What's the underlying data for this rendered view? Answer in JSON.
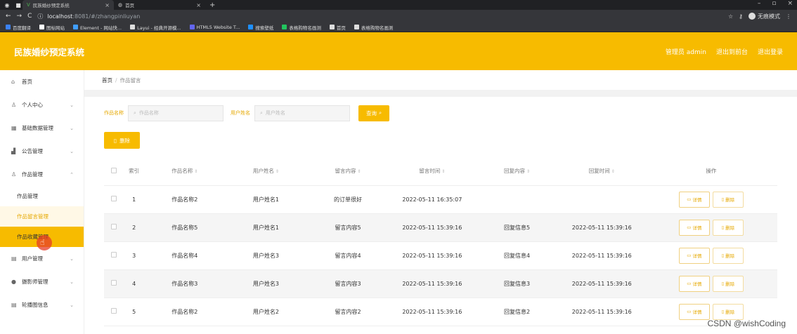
{
  "browser": {
    "tabs": [
      {
        "title": "民族婚纱预定系统",
        "active": true
      },
      {
        "title": "首页",
        "active": false
      }
    ],
    "url_host": "localhost",
    "url_path": ":8081/#/zhangpinliuyan",
    "profile_label": "无痕模式",
    "bookmarks": [
      {
        "label": "百度翻译",
        "color": "#3b82f6"
      },
      {
        "label": "图标网站",
        "color": "#ffffff"
      },
      {
        "label": "Element - 网站快...",
        "color": "#409eff"
      },
      {
        "label": "Layui - 经典开源模...",
        "color": "#dddddd"
      },
      {
        "label": "HTML5 Website T...",
        "color": "#6366f1"
      },
      {
        "label": "搜索壁纸",
        "color": "#1e90ff"
      },
      {
        "label": "表格购物名画测",
        "color": "#22c55e"
      },
      {
        "label": "首页",
        "color": "#dddddd"
      },
      {
        "label": "表格购物名画测",
        "color": "#dddddd"
      }
    ]
  },
  "header": {
    "brand": "民族婚纱预定系统",
    "user": "管理员 admin",
    "back_label": "退出到前台",
    "logout_label": "退出登录"
  },
  "sidebar": {
    "items": [
      {
        "label": "首页",
        "icon": "home-icon",
        "glyph": "⌂",
        "chevron": false
      },
      {
        "label": "个人中心",
        "icon": "user-icon",
        "glyph": "♙",
        "chevron": true
      },
      {
        "label": "基础数据管理",
        "icon": "grid-icon",
        "glyph": "▦",
        "chevron": true
      },
      {
        "label": "公告管理",
        "icon": "chart-icon",
        "glyph": "▟",
        "chevron": true
      },
      {
        "label": "作品管理",
        "icon": "user-icon",
        "glyph": "♙",
        "chevron": true,
        "expanded": true
      }
    ],
    "sub_items": [
      "作品管理",
      "作品留言管理",
      "作品收藏管理"
    ],
    "items_after": [
      {
        "label": "用户管理",
        "icon": "list-icon",
        "glyph": "▤"
      },
      {
        "label": "摄影师管理",
        "icon": "pin-icon",
        "glyph": "●"
      },
      {
        "label": "轮播图信息",
        "icon": "list-icon",
        "glyph": "▤"
      }
    ]
  },
  "breadcrumb": {
    "home": "首页",
    "current": "作品留言"
  },
  "search": {
    "label1": "作品名称",
    "placeholder1": "作品名称",
    "label2": "用户姓名",
    "placeholder2": "用户姓名",
    "query_label": "查询"
  },
  "delete_label": "删除",
  "table": {
    "headers": [
      "索引",
      "作品名称",
      "用户姓名",
      "留言内容",
      "留言时间",
      "回复内容",
      "回复时间",
      "操作"
    ],
    "rows": [
      [
        "1",
        "作品名称2",
        "用户姓名1",
        "的订单很好",
        "2022-05-11 16:35:07",
        "",
        ""
      ],
      [
        "2",
        "作品名称5",
        "用户姓名1",
        "留言内容5",
        "2022-05-11 15:39:16",
        "回复信息5",
        "2022-05-11 15:39:16"
      ],
      [
        "3",
        "作品名称4",
        "用户姓名3",
        "留言内容4",
        "2022-05-11 15:39:16",
        "回复信息4",
        "2022-05-11 15:39:16"
      ],
      [
        "4",
        "作品名称3",
        "用户姓名3",
        "留言内容3",
        "2022-05-11 15:39:16",
        "回复信息3",
        "2022-05-11 15:39:16"
      ],
      [
        "5",
        "作品名称2",
        "用户姓名2",
        "留言内容2",
        "2022-05-11 15:39:16",
        "回复信息2",
        "2022-05-11 15:39:16"
      ]
    ],
    "detail_label": "详情",
    "row_delete_label": "删除"
  },
  "watermark": "CSDN @wishCoding",
  "colors": {
    "accent": "#f7bb00"
  }
}
